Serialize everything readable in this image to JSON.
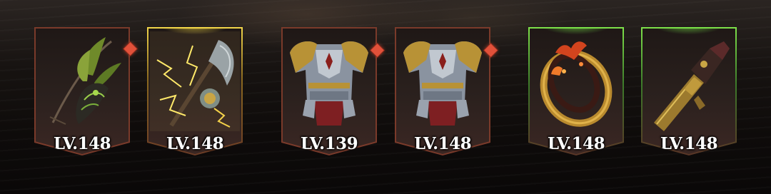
{
  "equipment": [
    {
      "slot": "leaf-bow",
      "level_text": "LV.148",
      "rarity": "normal",
      "new_badge": true,
      "accent": "#7a3a2a"
    },
    {
      "slot": "lightning-axe",
      "level_text": "LV.148",
      "rarity": "gold",
      "new_badge": false,
      "accent": "#f2d64a"
    },
    {
      "slot": "plate-armor",
      "level_text": "LV.139",
      "rarity": "normal",
      "new_badge": true,
      "accent": "#7a3a2a"
    },
    {
      "slot": "plate-armor",
      "level_text": "LV.148",
      "rarity": "normal",
      "new_badge": true,
      "accent": "#7a3a2a"
    },
    {
      "slot": "flame-ring",
      "level_text": "LV.148",
      "rarity": "green",
      "new_badge": false,
      "accent": "#7ee24a"
    },
    {
      "slot": "golden-pistol",
      "level_text": "LV.148",
      "rarity": "green",
      "new_badge": false,
      "accent": "#7ee24a"
    }
  ],
  "badge_color": "#e1513a"
}
